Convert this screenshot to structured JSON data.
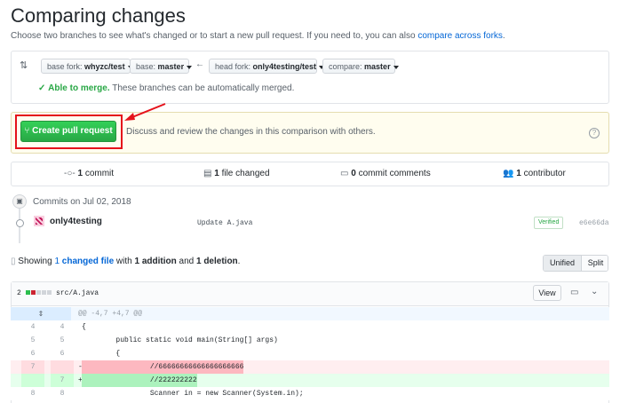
{
  "page": {
    "title": "Comparing changes",
    "subtitle": "Choose two branches to see what's changed or to start a new pull request. If you need to, you can also",
    "subtitle_link": "compare across forks",
    "subtitle_end": "."
  },
  "compare": {
    "base_fork_label": "base fork:",
    "base_fork_value": "whyzc/test",
    "base_label": "base:",
    "base_value": "master",
    "head_fork_label": "head fork:",
    "head_fork_value": "only4testing/test",
    "compare_label": "compare:",
    "compare_value": "master",
    "merge_status": "Able to merge.",
    "merge_text": "These branches can be automatically merged."
  },
  "pr": {
    "button_label": "Create pull request",
    "description": "Discuss and review the changes in this comparison with others."
  },
  "stats": {
    "commits_count": "1",
    "commits_label": "commit",
    "files_count": "1",
    "files_label": "file changed",
    "comments_count": "0",
    "comments_label": "commit comments",
    "contributors_count": "1",
    "contributors_label": "contributor"
  },
  "commits": {
    "date_header": "Commits on Jul 02, 2018",
    "author": "only4testing",
    "message": "Update A.java",
    "badge": "Verified",
    "sha": "e6e66da"
  },
  "summary": {
    "showing": "Showing",
    "count": "1",
    "changed_file": "changed file",
    "with": "with",
    "additions": "1 addition",
    "and": "and",
    "deletions": "1 deletion",
    "end": ".",
    "unified": "Unified",
    "split": "Split"
  },
  "file": {
    "changes": "2",
    "path": "src/A.java",
    "view_button": "View",
    "hunk": "@@ -4,7 +4,7 @@",
    "lines": [
      {
        "old": "4",
        "new": "4",
        "sign": "",
        "code": "{",
        "type": "ctx"
      },
      {
        "old": "5",
        "new": "5",
        "sign": "",
        "code": "        public static void main(String[] args)",
        "type": "ctx"
      },
      {
        "old": "6",
        "new": "6",
        "sign": "",
        "code": "        {",
        "type": "ctx"
      },
      {
        "old": "7",
        "new": "",
        "sign": "-",
        "code": "                //66666666666666666666",
        "type": "del"
      },
      {
        "old": "",
        "new": "7",
        "sign": "+",
        "code": "                //222222222",
        "type": "add"
      },
      {
        "old": "8",
        "new": "8",
        "sign": "",
        "code": "                Scanner in = new Scanner(System.in);",
        "type": "ctx"
      }
    ]
  },
  "colors": {
    "link": "#0366d6",
    "green": "#28a745",
    "red_highlight": "#e5121b",
    "del_bg": "#ffeef0",
    "add_bg": "#e6ffed",
    "hunk_bg": "#f1f8ff"
  }
}
